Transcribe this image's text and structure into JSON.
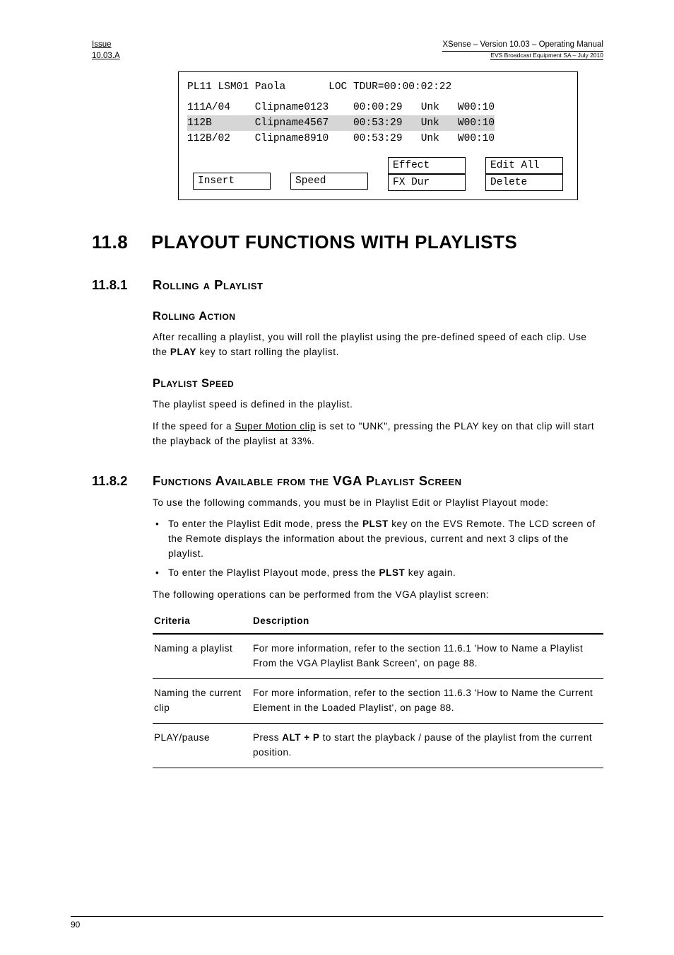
{
  "header": {
    "issue": "Issue",
    "issue_no": "10.03.A",
    "product": "XSense – Version 10.03 – Operating Manual",
    "company": "EVS Broadcast Equipment SA – July 2010"
  },
  "lcd": {
    "title_left": "PL11 LSM01 Paola",
    "title_right": "LOC TDUR=00:00:02:22",
    "rows": [
      {
        "id": "111A/04",
        "name": "Clipname0123",
        "tc": "00:00:29",
        "spd": "Unk",
        "fx": "W00:10",
        "hi": false
      },
      {
        "id": "112B",
        "name": "Clipname4567",
        "tc": "00:53:29",
        "spd": "Unk",
        "fx": "W00:10",
        "hi": true
      },
      {
        "id": "112B/02",
        "name": "Clipname8910",
        "tc": "00:53:29",
        "spd": "Unk",
        "fx": "W00:10",
        "hi": false
      }
    ],
    "buttons": {
      "c1_top": "",
      "c1_bot": "Insert",
      "c2_top": "",
      "c2_bot": "Speed",
      "c3_top": "Effect",
      "c3_bot": "FX Dur",
      "c4_top": "Edit All",
      "c4_bot": "Delete"
    }
  },
  "sec": {
    "num": "11.8",
    "title": "PLAYOUT FUNCTIONS WITH PLAYLISTS"
  },
  "s1": {
    "num": "11.8.1",
    "title": "Rolling a Playlist",
    "rolling_action": {
      "h": "Rolling Action",
      "p_pre": "After recalling a playlist, you will roll the playlist using the pre-defined speed of each clip. Use the ",
      "key": "PLAY",
      "p_post": " key to start rolling the playlist."
    },
    "playlist_speed": {
      "h": "Playlist Speed",
      "p1": "The playlist speed is defined in the playlist.",
      "p2_pre": "If the speed for a ",
      "p2_ul": "Super Motion clip",
      "p2_post": " is set to \"UNK\", pressing the PLAY key on that clip will start the playback of the playlist at 33%."
    }
  },
  "s2": {
    "num": "11.8.2",
    "title": "Functions Available from the VGA Playlist Screen",
    "intro": "To use the following commands, you must be in Playlist Edit or Playlist Playout mode:",
    "bul1_pre": "To enter the Playlist Edit mode, press the ",
    "bul1_key": "PLST",
    "bul1_post": " key on the EVS Remote. The LCD screen of the Remote displays the information about the previous, current and next 3 clips of the playlist.",
    "bul2_pre": "To enter the Playlist Playout mode, press the ",
    "bul2_key": "PLST",
    "bul2_post": " key again.",
    "after": "The following operations can be performed from the VGA playlist screen:",
    "table": {
      "h1": "Criteria",
      "h2": "Description",
      "rows": [
        {
          "c": "Naming a playlist",
          "d": "For more information, refer to the section 11.6.1 'How to Name a Playlist From the VGA Playlist Bank Screen', on page 88."
        },
        {
          "c": "Naming the current clip",
          "d": "For more information, refer to the section 11.6.3 'How to Name the Current Element in the Loaded Playlist', on page 88."
        },
        {
          "c": "PLAY/pause",
          "d_pre": "Press ",
          "d_key": "ALT + P",
          "d_post": " to start the playback / pause of the playlist from the current position."
        }
      ]
    }
  },
  "footer": {
    "page": "90"
  }
}
